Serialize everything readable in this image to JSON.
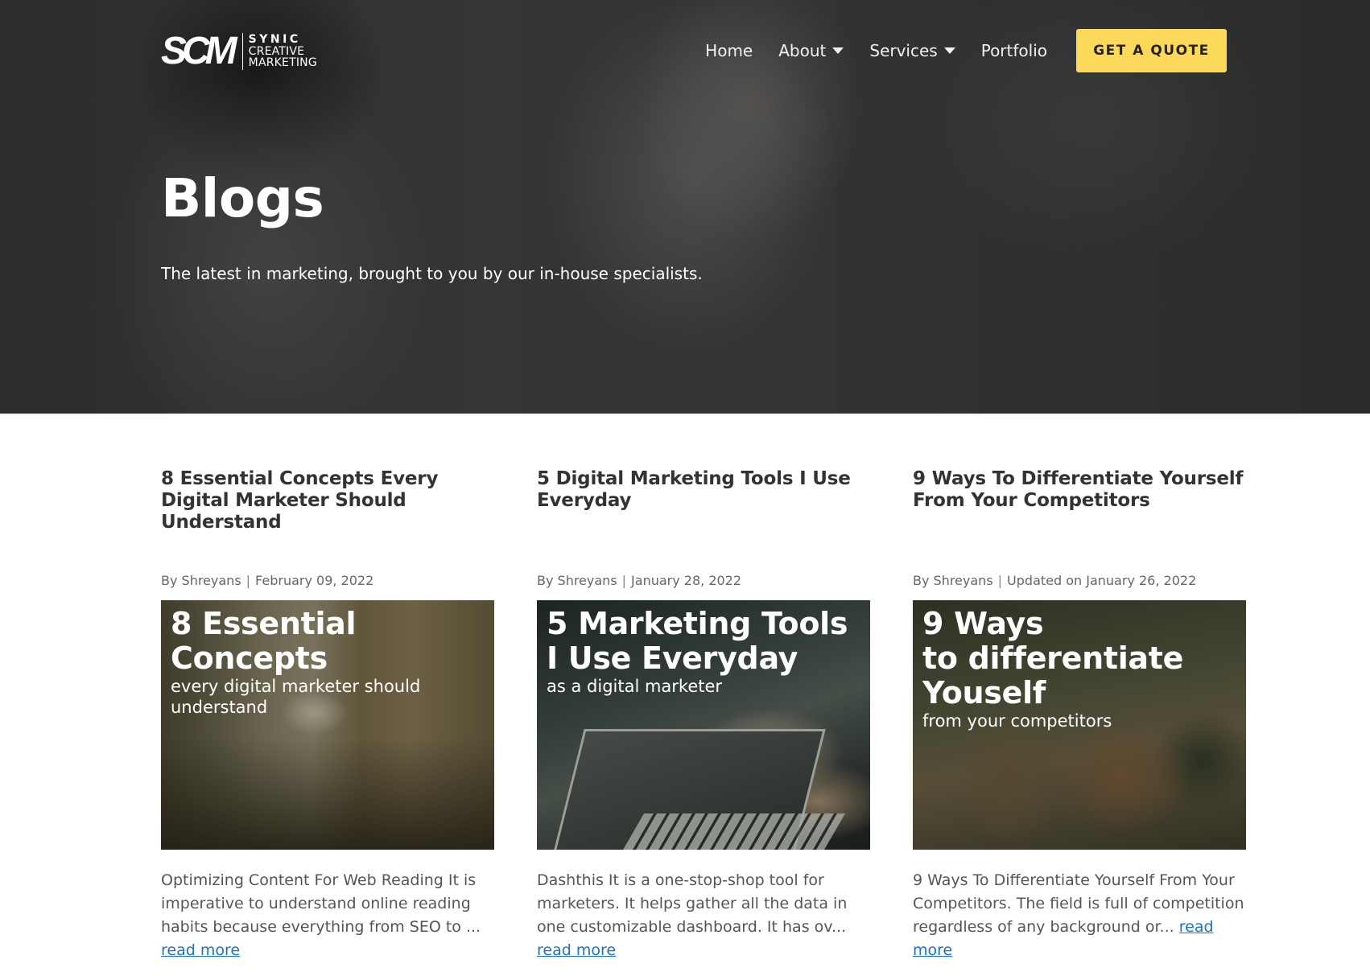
{
  "header": {
    "logo_mark": "SCM",
    "logo_line1": "SYNIC",
    "logo_line2": "CREATIVE",
    "logo_line3": "MARKETING",
    "nav": [
      {
        "label": "Home",
        "has_dropdown": false
      },
      {
        "label": "About",
        "has_dropdown": true
      },
      {
        "label": "Services",
        "has_dropdown": true
      },
      {
        "label": "Portfolio",
        "has_dropdown": false
      }
    ],
    "cta_label": "GET A QUOTE",
    "cta_color": "#fcd95a"
  },
  "hero": {
    "title": "Blogs",
    "subtitle": "The latest in marketing, brought to you by our in-house specialists."
  },
  "posts": [
    {
      "title": "8 Essential Concepts Every Digital Marketer Should Understand",
      "author": "By Shreyans",
      "date": "February 09, 2022",
      "image_title_big": "8 Essential Concepts",
      "image_title_small": "every digital marketer should understand",
      "excerpt": "Optimizing Content For Web Reading It is imperative to understand online reading habits because everything from SEO to ...",
      "read_more": "read more"
    },
    {
      "title": "5 Digital Marketing Tools I Use Everyday",
      "author": "By Shreyans",
      "date": "January 28, 2022",
      "image_title_big_1": "5 Marketing Tools",
      "image_title_big_2": "I Use Everyday",
      "image_title_small": "as a digital marketer",
      "excerpt": "Dashthis It is a one-stop-shop tool for marketers. It helps gather all the data in one customizable dashboard. It has ov...",
      "read_more": "read more"
    },
    {
      "title": "9 Ways To Differentiate Yourself From Your Competitors",
      "author": "By Shreyans",
      "date": "Updated on January 26, 2022",
      "image_title_big_1": "9 Ways",
      "image_title_big_2": "to differentiate Youself",
      "image_title_small": "from your competitors",
      "excerpt": "9 Ways To Differentiate Yourself From Your Competitors. The field is full of competition regardless of any background or...",
      "read_more": "read more"
    }
  ],
  "colors": {
    "link": "#1a73c8",
    "heading": "#333333"
  }
}
